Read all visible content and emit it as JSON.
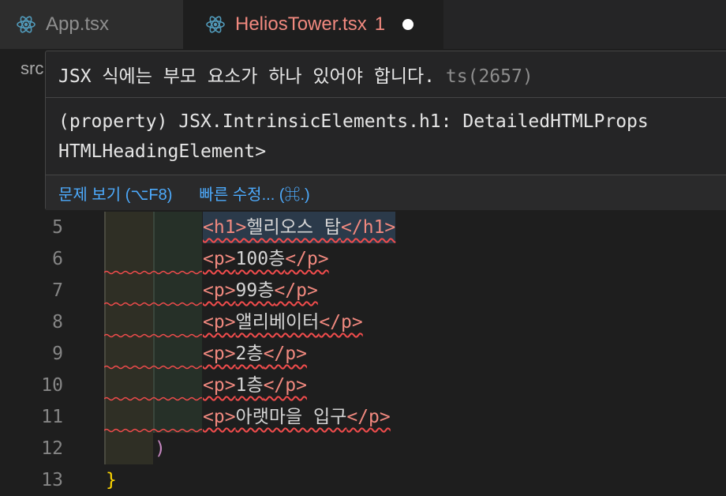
{
  "tabs": [
    {
      "label": "App.tsx",
      "icon": "react-icon"
    },
    {
      "label": "HeliosTower.tsx",
      "problem_count": "1",
      "icon": "react-icon",
      "dirty": true
    }
  ],
  "breadcrumb": {
    "text": "src"
  },
  "hover": {
    "error_message": "JSX 식에는 부모 요소가 하나 있어야 합니다.",
    "error_code": "ts(2657)",
    "signature_line1": "(property) JSX.IntrinsicElements.h1: DetailedHTMLProps",
    "signature_line2": "HTMLHeadingElement>",
    "actions": {
      "view_problem": "문제 보기 (⌥F8)",
      "quick_fix": "빠른 수정... (⌘.)"
    }
  },
  "editor": {
    "lines": [
      {
        "num": "5",
        "open": "<h1>",
        "text": "헬리오스 탑",
        "close": "</h1>"
      },
      {
        "num": "6",
        "open": "<p>",
        "text": "100층",
        "close": "</p>"
      },
      {
        "num": "7",
        "open": "<p>",
        "text": "99층",
        "close": "</p>"
      },
      {
        "num": "8",
        "open": "<p>",
        "text": "앨리베이터",
        "close": "</p>"
      },
      {
        "num": "9",
        "open": "<p>",
        "text": "2층",
        "close": "</p>"
      },
      {
        "num": "10",
        "open": "<p>",
        "text": "1층",
        "close": "</p>"
      },
      {
        "num": "11",
        "open": "<p>",
        "text": "아랫마을 입구",
        "close": "</p>"
      },
      {
        "num": "12",
        "paren": ")"
      },
      {
        "num": "13",
        "brace": "}"
      }
    ]
  },
  "colors": {
    "tag": "#f1897f",
    "error_squiggle": "#f14c4c",
    "link": "#4daafc",
    "paren": "#c586c0",
    "brace": "#ffd700"
  }
}
